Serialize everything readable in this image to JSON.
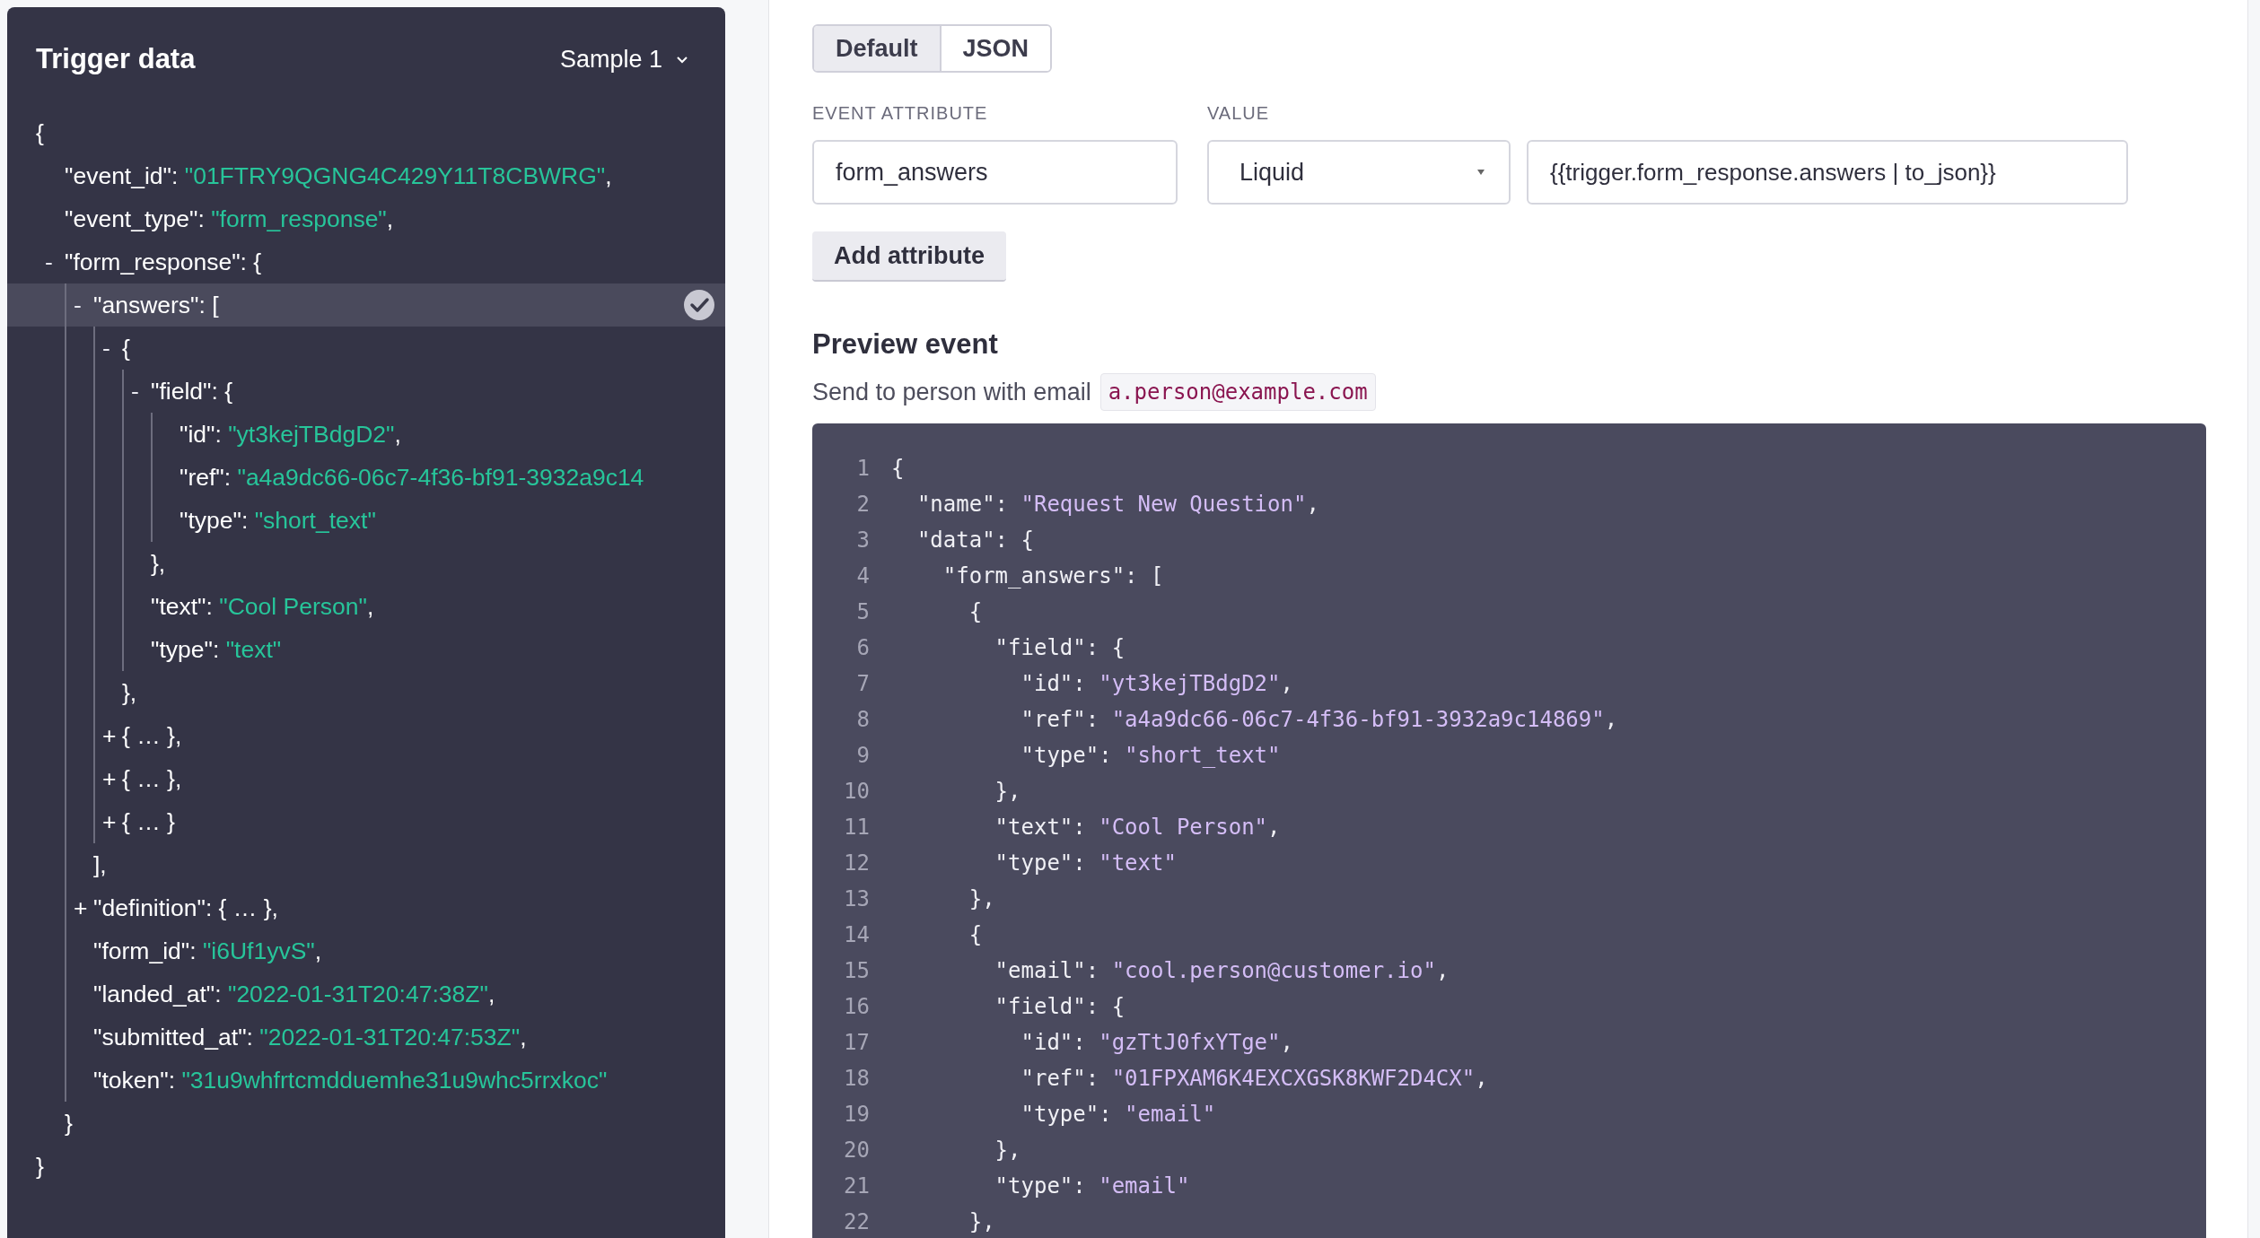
{
  "trigger_panel": {
    "title": "Trigger data",
    "sample_picker": {
      "label": "Sample 1"
    },
    "tree": {
      "open": "{",
      "close": "}",
      "children": [
        {
          "kind": "leaf",
          "key": "\"event_id\": ",
          "value": "\"01FTRY9QGNG4C429Y11T8CBWRG\"",
          "tail": ","
        },
        {
          "kind": "leaf",
          "key": "\"event_type\": ",
          "value": "\"form_response\"",
          "tail": ","
        },
        {
          "kind": "branch",
          "toggle": "-",
          "label": "\"form_response\": {",
          "expanded": true,
          "selected": false,
          "close": "}",
          "children": [
            {
              "kind": "branch",
              "toggle": "-",
              "label": "\"answers\": [",
              "expanded": true,
              "selected": true,
              "close": "],",
              "children": [
                {
                  "kind": "branch",
                  "toggle": "-",
                  "label": "{",
                  "expanded": true,
                  "selected": false,
                  "close": "},",
                  "children": [
                    {
                      "kind": "branch",
                      "toggle": "-",
                      "label": "\"field\": {",
                      "expanded": true,
                      "selected": false,
                      "close": "},",
                      "children": [
                        {
                          "kind": "leaf",
                          "key": "\"id\": ",
                          "value": "\"yt3kejTBdgD2\"",
                          "tail": ","
                        },
                        {
                          "kind": "leaf",
                          "key": "\"ref\": ",
                          "value": "\"a4a9dc66-06c7-4f36-bf91-3932a9c14"
                        },
                        {
                          "kind": "leaf",
                          "key": "\"type\": ",
                          "value": "\"short_text\""
                        }
                      ]
                    },
                    {
                      "kind": "leaf",
                      "key": "\"text\": ",
                      "value": "\"Cool Person\"",
                      "tail": ","
                    },
                    {
                      "kind": "leaf",
                      "key": "\"type\": ",
                      "value": "\"text\""
                    }
                  ]
                },
                {
                  "kind": "branch",
                  "toggle": "+",
                  "label": "{ … },",
                  "expanded": false,
                  "selected": false
                },
                {
                  "kind": "branch",
                  "toggle": "+",
                  "label": "{ … },",
                  "expanded": false,
                  "selected": false
                },
                {
                  "kind": "branch",
                  "toggle": "+",
                  "label": "{ … }",
                  "expanded": false,
                  "selected": false
                }
              ]
            },
            {
              "kind": "branch",
              "toggle": "+",
              "label": "\"definition\": { … },",
              "expanded": false,
              "selected": false
            },
            {
              "kind": "leaf",
              "key": "\"form_id\": ",
              "value": "\"i6Uf1yvS\"",
              "tail": ","
            },
            {
              "kind": "leaf",
              "key": "\"landed_at\": ",
              "value": "\"2022-01-31T20:47:38Z\"",
              "tail": ","
            },
            {
              "kind": "leaf",
              "key": "\"submitted_at\": ",
              "value": "\"2022-01-31T20:47:53Z\"",
              "tail": ","
            },
            {
              "kind": "leaf",
              "key": "\"token\": ",
              "value": "\"31u9whfrtcmdduemhe31u9whc5rrxkoc\""
            }
          ]
        }
      ]
    }
  },
  "view_toggle": [
    {
      "label": "Default",
      "selected": true
    },
    {
      "label": "JSON",
      "selected": false
    }
  ],
  "attribute": {
    "label": "EVENT ATTRIBUTE",
    "value": "form_answers"
  },
  "value": {
    "label": "VALUE",
    "type": "Liquid",
    "expression": "{{trigger.form_response.answers | to_json}}"
  },
  "add_button": "Add attribute",
  "preview": {
    "title": "Preview event",
    "recipient_label": "Send to person with email",
    "recipient": "a.person@example.com",
    "lines": [
      {
        "num": "1",
        "code": "{"
      },
      {
        "num": "2",
        "code": "  \"name\": ",
        "string": "\"Request New Question\"",
        "tail": ","
      },
      {
        "num": "3",
        "code": "  \"data\": {"
      },
      {
        "num": "4",
        "code": "    \"form_answers\": ["
      },
      {
        "num": "5",
        "code": "      {"
      },
      {
        "num": "6",
        "code": "        \"field\": {"
      },
      {
        "num": "7",
        "code": "          \"id\": ",
        "string": "\"yt3kejTBdgD2\"",
        "tail": ","
      },
      {
        "num": "8",
        "code": "          \"ref\": ",
        "string": "\"a4a9dc66-06c7-4f36-bf91-3932a9c14869\"",
        "tail": ","
      },
      {
        "num": "9",
        "code": "          \"type\": ",
        "string": "\"short_text\""
      },
      {
        "num": "10",
        "code": "        },"
      },
      {
        "num": "11",
        "code": "        \"text\": ",
        "string": "\"Cool Person\"",
        "tail": ","
      },
      {
        "num": "12",
        "code": "        \"type\": ",
        "string": "\"text\""
      },
      {
        "num": "13",
        "code": "      },"
      },
      {
        "num": "14",
        "code": "      {"
      },
      {
        "num": "15",
        "code": "        \"email\": ",
        "string": "\"cool.person@customer.io\"",
        "tail": ","
      },
      {
        "num": "16",
        "code": "        \"field\": {"
      },
      {
        "num": "17",
        "code": "          \"id\": ",
        "string": "\"gzTtJ0fxYTge\"",
        "tail": ","
      },
      {
        "num": "18",
        "code": "          \"ref\": ",
        "string": "\"01FPXAM6K4EXCXGSK8KWF2D4CX\"",
        "tail": ","
      },
      {
        "num": "19",
        "code": "          \"type\": ",
        "string": "\"email\""
      },
      {
        "num": "20",
        "code": "        },"
      },
      {
        "num": "21",
        "code": "        \"type\": ",
        "string": "\"email\""
      },
      {
        "num": "22",
        "code": "      },"
      }
    ]
  }
}
